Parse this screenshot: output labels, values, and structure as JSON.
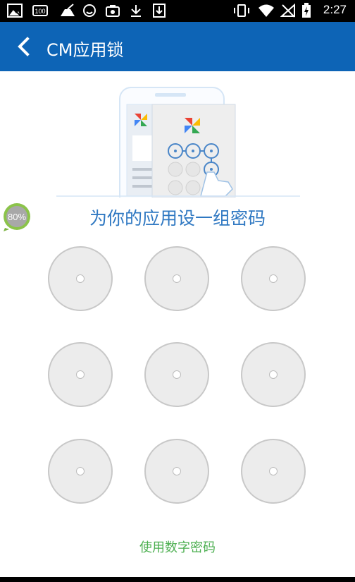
{
  "status_bar": {
    "time": "2:27",
    "icons": [
      "picture-icon",
      "battery-100-icon",
      "broom-icon",
      "smiley-icon",
      "camera-icon",
      "download-icon",
      "download-box-icon",
      "vibrate-icon",
      "wifi-icon",
      "no-sim-icon",
      "battery-charging-icon"
    ]
  },
  "header": {
    "title": "CM应用锁",
    "back_icon": "chevron-left-icon"
  },
  "floating_badge": {
    "label": "80%"
  },
  "main": {
    "prompt": "为你的应用设一组密码",
    "pattern_nodes": 9,
    "use_numeric_label": "使用数字密码"
  },
  "colors": {
    "accent": "#0d64b6",
    "prompt": "#2f78c2",
    "link": "#4caf50"
  }
}
